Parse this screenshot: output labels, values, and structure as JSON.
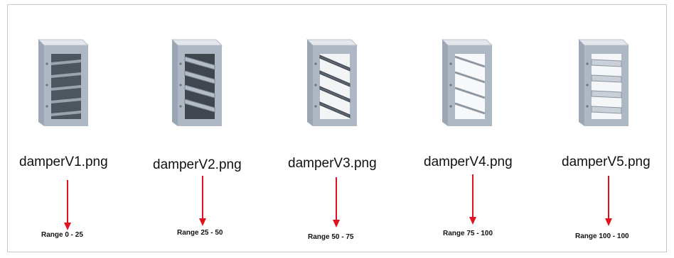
{
  "files": [
    {
      "name": "damperV1.png",
      "range": "Range 0 - 25",
      "icon": "damper-icon",
      "slat_state": "closed"
    },
    {
      "name": "damperV2.png",
      "range": "Range 25 - 50",
      "icon": "damper-icon",
      "slat_state": "quarter-open"
    },
    {
      "name": "damperV3.png",
      "range": "Range 50 - 75",
      "icon": "damper-icon",
      "slat_state": "half-open"
    },
    {
      "name": "damperV4.png",
      "range": "Range 75 - 100",
      "icon": "damper-icon",
      "slat_state": "three-quarter-open"
    },
    {
      "name": "damperV5.png",
      "range": "Range 100 - 100",
      "icon": "damper-icon",
      "slat_state": "open"
    }
  ],
  "colors": {
    "arrow": "#e0141e",
    "frame_border": "#c8c8c8",
    "damper_metal": "#8a97a6"
  }
}
